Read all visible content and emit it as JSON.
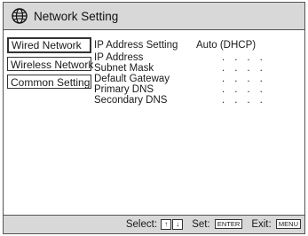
{
  "header": {
    "title": "Network Setting",
    "icon": "globe-icon"
  },
  "tabs": [
    {
      "label": "Wired Network",
      "active": true
    },
    {
      "label": "Wireless Network",
      "active": false
    },
    {
      "label": "Common Setting",
      "active": false
    }
  ],
  "settings": [
    {
      "label": "IP Address Setting",
      "value": "Auto (DHCP)"
    },
    {
      "label": "IP Address",
      "value": "...."
    },
    {
      "label": "Subnet Mask",
      "value": "...."
    },
    {
      "label": "Default Gateway",
      "value": "...."
    },
    {
      "label": "Primary DNS",
      "value": "...."
    },
    {
      "label": "Secondary DNS",
      "value": "...."
    }
  ],
  "footer": {
    "select_label": "Select:",
    "select_up": "↑",
    "select_down": "↓",
    "set_label": "Set:",
    "set_key": "ENTER",
    "exit_label": "Exit:",
    "exit_key": "MENU"
  }
}
